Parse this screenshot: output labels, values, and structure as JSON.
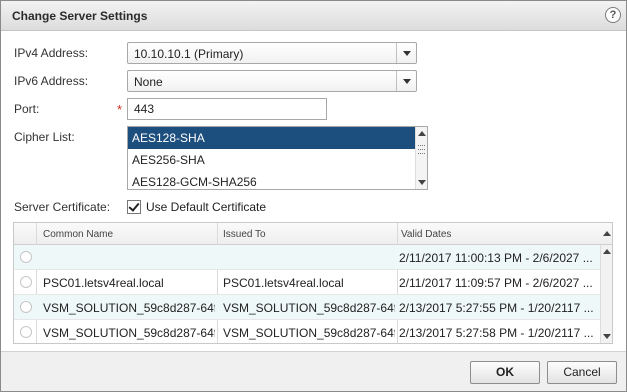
{
  "dialog": {
    "title": "Change Server Settings",
    "help": "?"
  },
  "form": {
    "ipv4_label": "IPv4 Address:",
    "ipv4_value": "10.10.10.1 (Primary)",
    "ipv6_label": "IPv6 Address:",
    "ipv6_value": "None",
    "port_label": "Port:",
    "port_value": "443",
    "required_mark": "*",
    "cipher_label": "Cipher List:",
    "cipher_options": [
      "AES128-SHA",
      "AES256-SHA",
      "AES128-GCM-SHA256"
    ],
    "cert_label": "Server Certificate:",
    "use_default_label": "Use Default Certificate",
    "use_default_checked": true
  },
  "grid": {
    "columns": [
      "Common Name",
      "Issued To",
      "Valid Dates"
    ],
    "rows": [
      {
        "common_name": "",
        "issued_to": "",
        "valid_dates": "2/11/2017 11:00:13 PM - 2/6/2027 ..."
      },
      {
        "common_name": "PSC01.letsv4real.local",
        "issued_to": "PSC01.letsv4real.local",
        "valid_dates": "2/11/2017 11:09:57 PM - 2/6/2027 ..."
      },
      {
        "common_name": "VSM_SOLUTION_59c8d287-64f",
        "issued_to": "VSM_SOLUTION_59c8d287-64f",
        "valid_dates": "2/13/2017 5:27:55 PM - 1/20/2117 ..."
      },
      {
        "common_name": "VSM_SOLUTION_59c8d287-64f",
        "issued_to": "VSM_SOLUTION_59c8d287-64f",
        "valid_dates": "2/13/2017 5:27:58 PM - 1/20/2117 ..."
      }
    ]
  },
  "footer": {
    "ok_label": "OK",
    "cancel_label": "Cancel"
  },
  "colors": {
    "selected_option": "#1d4f7e",
    "alt_row": "#eef8f8",
    "required": "#d62d20"
  }
}
